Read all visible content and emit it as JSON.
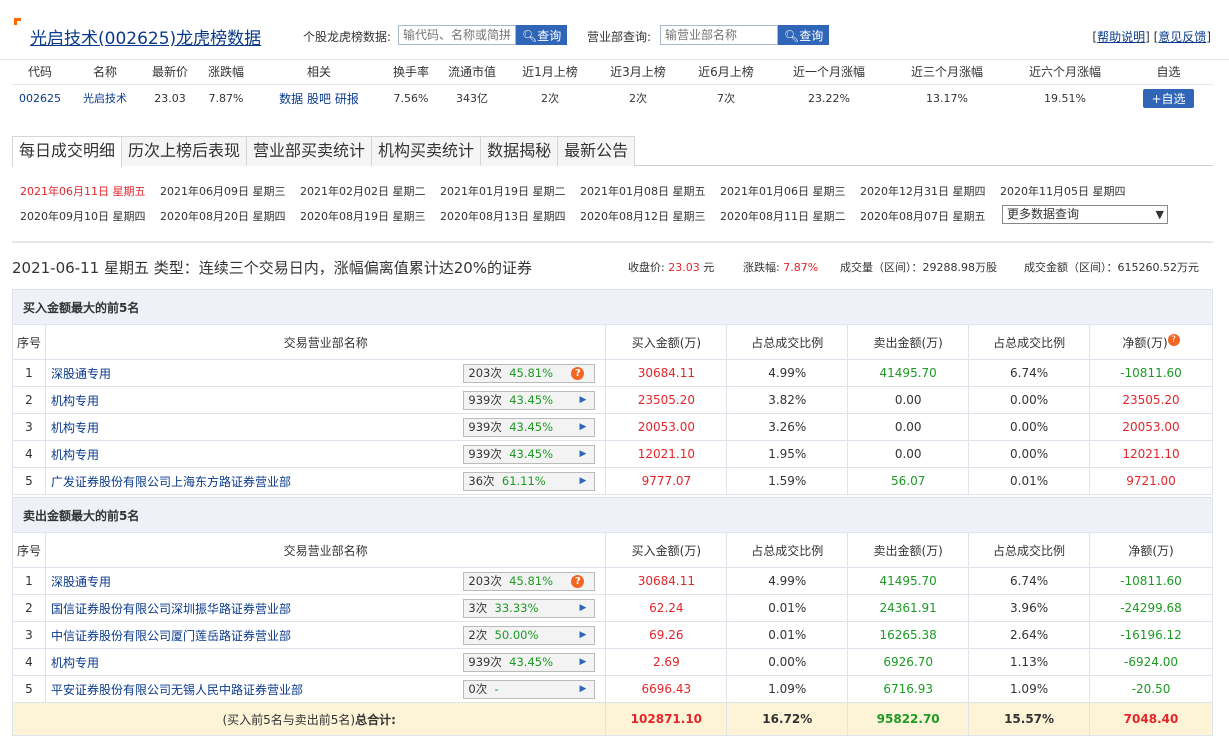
{
  "header": {
    "title": "光启技术(002625)龙虎榜数据",
    "q1_label": "个股龙虎榜数据:",
    "q1_placeholder": "输代码、名称或简拼",
    "q_btn": "查询",
    "q2_label": "营业部查询:",
    "q2_placeholder": "输营业部名称",
    "help": "帮助说明",
    "feedback": "意见反馈"
  },
  "quote": {
    "headers": [
      "代码",
      "名称",
      "最新价",
      "涨跌幅",
      "相关",
      "换手率",
      "流通市值",
      "近1月上榜",
      "近3月上榜",
      "近6月上榜",
      "近一个月涨幅",
      "近三个月涨幅",
      "近六个月涨幅",
      "自选"
    ],
    "code": "002625",
    "name": "光启技术",
    "price": "23.03",
    "change": "7.87%",
    "rel1": "数据",
    "rel2": "股吧",
    "rel3": "研报",
    "turnover": "7.56%",
    "mcap": "343亿",
    "m1": "2次",
    "m3": "2次",
    "m6": "7次",
    "r1": "23.22%",
    "r3": "13.17%",
    "r6": "19.51%",
    "add": "+自选"
  },
  "tabs": [
    "每日成交明细",
    "历次上榜后表现",
    "营业部买卖统计",
    "机构买卖统计",
    "数据揭秘",
    "最新公告"
  ],
  "dates_row1": [
    "2021年06月11日 星期五",
    "2021年06月09日 星期三",
    "2021年02月02日 星期二",
    "2021年01月19日 星期二",
    "2021年01月08日 星期五",
    "2021年01月06日 星期三",
    "2020年12月31日 星期四",
    "2020年11月05日 星期四"
  ],
  "dates_row2": [
    "2020年09月10日 星期四",
    "2020年08月20日 星期四",
    "2020年08月19日 星期三",
    "2020年08月13日 星期四",
    "2020年08月12日 星期三",
    "2020年08月11日 星期二",
    "2020年08月07日 星期五"
  ],
  "more": "更多数据查询",
  "info": {
    "text": "2021-06-11 星期五 类型：连续三个交易日内，涨幅偏离值累计达20%的证券",
    "close_l": "收盘价:",
    "close": "23.03",
    "close_u": "元",
    "chg_l": "涨跌幅:",
    "chg": "7.87%",
    "vol_l": "成交量（区间）：",
    "vol": "29288.98万股",
    "amt_l": "成交金额（区间）：",
    "amt": "615260.52万元"
  },
  "cols": [
    "序号",
    "交易营业部名称",
    "买入金额(万)",
    "占总成交比例",
    "卖出金额(万)",
    "占总成交比例",
    "净额(万)"
  ],
  "buy": {
    "title": "买入金额最大的前5名",
    "rows": [
      [
        "1",
        "深股通专用",
        "203次",
        "45.81%",
        "30684.11",
        "4.99%",
        "41495.70",
        "6.74%",
        "-10811.60"
      ],
      [
        "2",
        "机构专用",
        "939次",
        "43.45%",
        "23505.20",
        "3.82%",
        "0.00",
        "0.00%",
        "23505.20"
      ],
      [
        "3",
        "机构专用",
        "939次",
        "43.45%",
        "20053.00",
        "3.26%",
        "0.00",
        "0.00%",
        "20053.00"
      ],
      [
        "4",
        "机构专用",
        "939次",
        "43.45%",
        "12021.10",
        "1.95%",
        "0.00",
        "0.00%",
        "12021.10"
      ],
      [
        "5",
        "广发证券股份有限公司上海东方路证券营业部",
        "36次",
        "61.11%",
        "9777.07",
        "1.59%",
        "56.07",
        "0.01%",
        "9721.00"
      ]
    ]
  },
  "sell": {
    "title": "卖出金额最大的前5名",
    "rows": [
      [
        "1",
        "深股通专用",
        "203次",
        "45.81%",
        "30684.11",
        "4.99%",
        "41495.70",
        "6.74%",
        "-10811.60"
      ],
      [
        "2",
        "国信证券股份有限公司深圳振华路证券营业部",
        "3次",
        "33.33%",
        "62.24",
        "0.01%",
        "24361.91",
        "3.96%",
        "-24299.68"
      ],
      [
        "3",
        "中信证券股份有限公司厦门莲岳路证券营业部",
        "2次",
        "50.00%",
        "69.26",
        "0.01%",
        "16265.38",
        "2.64%",
        "-16196.12"
      ],
      [
        "4",
        "机构专用",
        "939次",
        "43.45%",
        "2.69",
        "0.00%",
        "6926.70",
        "1.13%",
        "-6924.00"
      ],
      [
        "5",
        "平安证券股份有限公司无锡人民中路证券营业部",
        "0次",
        "-",
        "6696.43",
        "1.09%",
        "6716.93",
        "1.09%",
        "-20.50"
      ]
    ]
  },
  "total": {
    "label_a": "(买入前5名与卖出前5名)",
    "label_b": "总合计:",
    "buy": "102871.10",
    "bp": "16.72%",
    "sell": "95822.70",
    "sp": "15.57%",
    "net": "7048.40"
  },
  "colors": {
    "up": "#e4252a",
    "down": "#1c9a23",
    "link": "#0a3a8c",
    "btn": "#2f66b7"
  }
}
